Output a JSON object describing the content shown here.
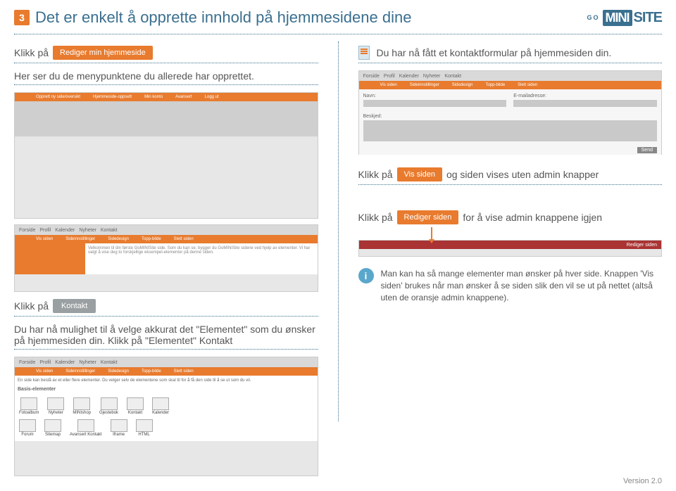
{
  "header": {
    "step": "3",
    "title": "Det er enkelt å opprette innhold på hjemmesidene dine",
    "logo_go": "GO",
    "logo_mini": "MINI",
    "logo_site": "SITE"
  },
  "left": {
    "line1_prefix": "Klikk på",
    "btn_edit": "Rediger min hjemmeside",
    "line2": "Her ser du de menypunktene du allerede har opprettet.",
    "ss_a_toolbar": [
      "Opprett ny side/oversikt",
      "Hjemmeside-oppsett",
      "Min konto",
      "Avansert",
      "Logg ut"
    ],
    "ss_b_tabs": [
      "Forside",
      "Profil",
      "Kalender",
      "Nyheter",
      "Kontakt"
    ],
    "ss_b_subnav": [
      "Vis siden",
      "Sideinnstillinger",
      "Sidedesign",
      "Topp-bilde",
      "Slett siden"
    ],
    "ss_b_welcome": "Velkommen til din første GoMINISite side.\nSom du kan se, bygger du GoMINISite sidene ved hjelp av elementer. Vi har valgt å vise deg to forskjellige eksempel-elementer på denne siden.",
    "line3_prefix": "Klikk på",
    "btn_kontakt": "Kontakt",
    "line4": "Du har nå mulighet til å velge akkurat det \"Elementet\" som du ønsker på hjemmesiden din. Klikk på \"Elementet\" Kontakt",
    "ss_d_tabs": [
      "Forside",
      "Profil",
      "Kalender",
      "Nyheter",
      "Kontakt"
    ],
    "ss_d_subnav": [
      "Vis siden",
      "Sideinnstillinger",
      "Sidedesign",
      "Topp-bilde",
      "Slett siden"
    ],
    "ss_d_intro": "En side kan bestå av et eller flere elementer. Du velger selv de elementene som skal til for å få den side til å se ut som du vil.",
    "ss_d_basis": "Basis-elementer",
    "ss_d_row1": [
      "Fotoalbum",
      "Nyheter",
      "MINIshop",
      "Gjestebok",
      "Kontakt",
      "Kalender"
    ],
    "ss_d_row2": [
      "Forum",
      "Sitemap",
      "Avansert Kontakt",
      "Iframe",
      "HTML"
    ]
  },
  "right": {
    "line1": "Du har nå fått et kontaktformular på hjemmesiden din.",
    "ss_c_tabs": [
      "Forside",
      "Profil",
      "Kalender",
      "Nyheter",
      "Kontakt"
    ],
    "ss_c_subnav": [
      "Vis siden",
      "Sideinnstillinger",
      "Sidedesign",
      "Topp-bilde",
      "Slett siden"
    ],
    "ss_c_field_name": "Navn:",
    "ss_c_field_email": "E-mailadresse:",
    "ss_c_field_msg": "Beskjed:",
    "ss_c_send": "Send",
    "line2_prefix": "Klikk på",
    "btn_vis": "Vis siden",
    "line2_suffix": "og siden vises uten admin knapper",
    "line3_prefix": "Klikk på",
    "btn_rediger": "Rediger siden",
    "line3_suffix": "for å vise admin knappene igjen",
    "ss_red_label": "Rediger siden",
    "info": "Man kan ha så mange elementer man ønsker på hver side. Knappen 'Vis siden' brukes når man ønsker å se siden slik den vil se ut på nettet (altså uten de oransje admin knappene)."
  },
  "footer": {
    "version": "Version 2.0"
  }
}
